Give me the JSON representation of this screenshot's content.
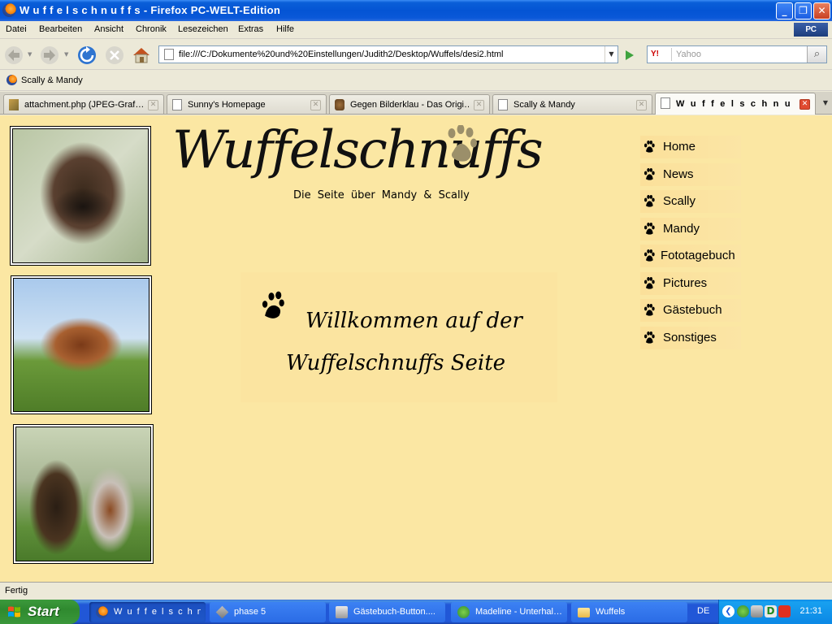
{
  "window": {
    "title": "W u f f e l s c h n u f f s - Firefox PC-WELT-Edition"
  },
  "menubar": {
    "items": [
      "Datei",
      "Bearbeiten",
      "Ansicht",
      "Chronik",
      "Lesezeichen",
      "Extras",
      "Hilfe"
    ],
    "brand": "PC WELT"
  },
  "navbar": {
    "url": "file:///C:/Dokumente%20und%20Einstellungen/Judith2/Desktop/Wuffels/desi2.html",
    "search_engine": "Y!",
    "search_placeholder": "Yahoo"
  },
  "bookmarks": {
    "items": [
      "Scally & Mandy"
    ]
  },
  "tabs": [
    {
      "label": "attachment.php (JPEG-Graf…",
      "active": false
    },
    {
      "label": "Sunny's Homepage",
      "active": false
    },
    {
      "label": "Gegen Bilderklau - Das Origi…",
      "active": false
    },
    {
      "label": "Scally & Mandy",
      "active": false
    },
    {
      "label": "W u f f e l s c h n u f f s",
      "active": true
    }
  ],
  "page": {
    "logo": "Wuffelschnuffs",
    "subtitle": "Die Seite über Mandy & Scally",
    "welcome_line1": "Willkommen auf der",
    "welcome_line2": "Wuffelschnuffs Seite",
    "nav": [
      "Home",
      "News",
      "Scally",
      "Mandy",
      "Fototagebuch",
      "Pictures",
      "Gästebuch",
      "Sonstiges"
    ],
    "colors": {
      "background": "#fbe7a3",
      "paw_logo": "#9b8f6a"
    }
  },
  "statusbar": {
    "text": "Fertig"
  },
  "taskbar": {
    "start_label": "Start",
    "tasks": [
      {
        "label": "W u f f e l s c h n u…",
        "active": true
      },
      {
        "label": "phase 5",
        "active": false
      },
      {
        "label": "Gästebuch-Button....",
        "active": false
      },
      {
        "label": "Madeline - Unterhal…",
        "active": false
      },
      {
        "label": "Wuffels",
        "active": false
      }
    ],
    "language": "DE",
    "clock": "21:31"
  }
}
